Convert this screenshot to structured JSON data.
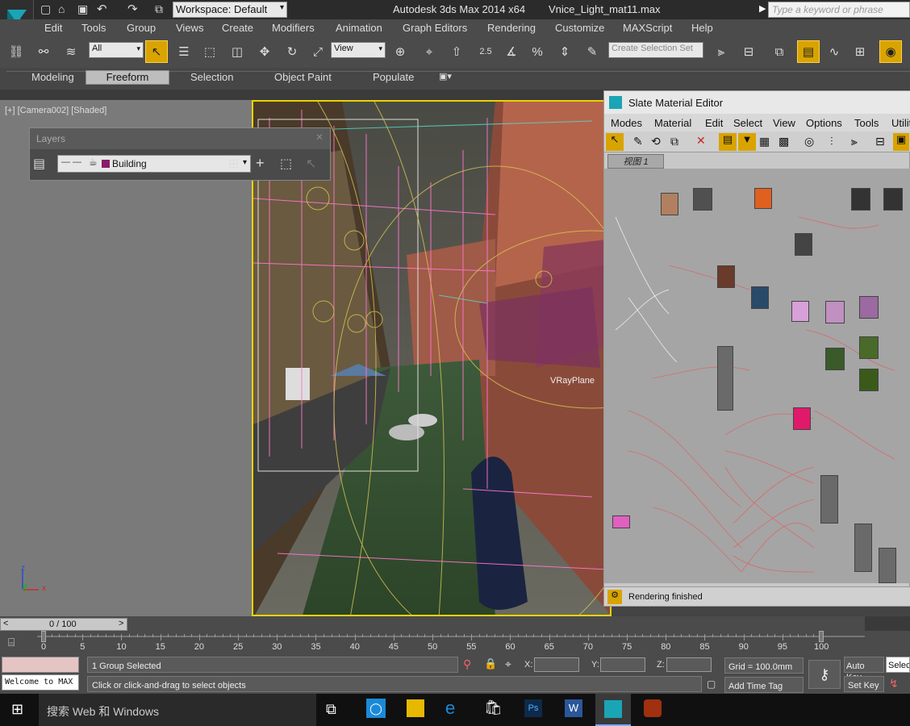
{
  "titlebar": {
    "workspace_label": "Workspace: Default",
    "app_title": "Autodesk 3ds Max  2014 x64",
    "file_name": "Vnice_Light_mat11.max",
    "search_placeholder": "Type a keyword or phrase"
  },
  "menubar": {
    "items": [
      "Edit",
      "Tools",
      "Group",
      "Views",
      "Create",
      "Modifiers",
      "Animation",
      "Graph Editors",
      "Rendering",
      "Customize",
      "MAXScript",
      "Help"
    ]
  },
  "toolbar": {
    "selection_filter": "All",
    "ref_coord": "View",
    "spinner_snap": "2.5",
    "named_selection_placeholder": "Create Selection Set"
  },
  "ribbon": {
    "tabs": [
      "Modeling",
      "Freeform",
      "Selection",
      "Object Paint",
      "Populate"
    ],
    "active_tab": "Freeform"
  },
  "viewport": {
    "label": "[+] [Camera002] [Shaded]",
    "axis_z": "z",
    "axis_y": "y",
    "axis_x": "x"
  },
  "layers_panel": {
    "title": "Layers",
    "current_layer": "Building",
    "layer_color": "#8a1a6a"
  },
  "camera_view": {
    "object_label": "VRayPlane"
  },
  "slate": {
    "title": "Slate Material Editor",
    "menu": [
      "Modes",
      "Material",
      "Edit",
      "Select",
      "View",
      "Options",
      "Tools",
      "Utilities"
    ],
    "view_tab": "视图 1",
    "status": "Rendering finished"
  },
  "timeline": {
    "frame_display": "0 / 100",
    "ticks": [
      "0",
      "5",
      "10",
      "15",
      "20",
      "25",
      "30",
      "35",
      "40",
      "45",
      "50",
      "55",
      "60",
      "65",
      "70",
      "75",
      "80",
      "85",
      "90",
      "95",
      "100"
    ]
  },
  "status": {
    "welcome": "Welcome to MAX",
    "selection_info": "1 Group Selected",
    "prompt": "Click or click-and-drag to select objects",
    "x_label": "X:",
    "y_label": "Y:",
    "z_label": "Z:",
    "grid": "Grid = 100.0mm",
    "add_time_tag": "Add Time Tag",
    "auto_key": "Auto Key",
    "set_key": "Set Key",
    "key_mode": "Selected"
  },
  "taskbar": {
    "search_text": "搜索 Web 和 Windows"
  },
  "colors": {
    "accent": "#e8d300",
    "highlight": "#d9a400",
    "node_header": "#cc4411"
  }
}
